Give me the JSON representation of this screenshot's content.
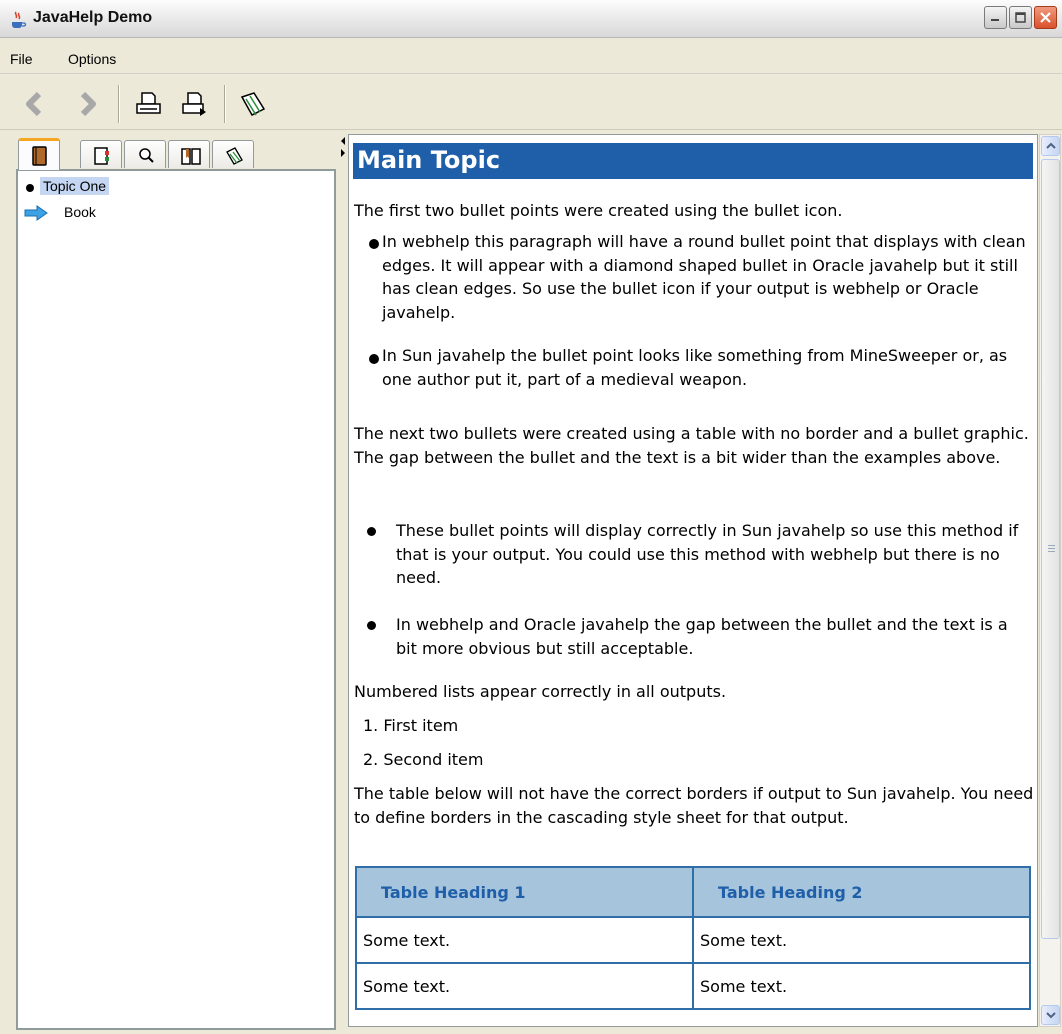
{
  "window": {
    "title": "JavaHelp Demo"
  },
  "menubar": {
    "items": [
      "File",
      "Options"
    ]
  },
  "toolbar": {
    "buttons": [
      "back-icon",
      "forward-icon",
      "print-icon",
      "page-setup-icon",
      "synchronize-icon"
    ]
  },
  "navigator": {
    "tabs": [
      "toc-icon",
      "index-icon",
      "search-icon",
      "glossary-icon",
      "favorites-icon"
    ],
    "items": [
      {
        "label": "Topic One",
        "icon": "bullet",
        "selected": true
      },
      {
        "label": "Book",
        "icon": "blue-arrow-icon"
      }
    ]
  },
  "content": {
    "heading": "Main Topic",
    "intro1": "The first two bullet points were created using the bullet icon.",
    "bullets1": [
      "In webhelp this paragraph will have a round bullet point that displays with clean edges. It will appear with a diamond shaped bullet in Oracle javahelp but it still has clean edges. So use the bullet icon if your output is webhelp or Oracle javahelp.",
      "In Sun javahelp the bullet point looks like something from MineSweeper or, as one author put it, part of a medieval weapon."
    ],
    "intro2": "The next two bullets were created using a table with no border and a bullet graphic. The gap between the bullet and the text is a bit wider than the examples above.",
    "bullets2": [
      "These bullet points will display correctly in Sun javahelp so use this method if that is your output. You could use this method with webhelp but there is no need.",
      "In webhelp and Oracle javahelp the gap between the bullet and the text is a bit more obvious but still acceptable."
    ],
    "intro3": "Numbered lists appear correctly in all outputs.",
    "numbered": [
      "1. First item",
      "2. Second item"
    ],
    "intro4": "The table below will not have the correct borders if output to Sun javahelp. You need to define borders in the cascading style sheet for that output.",
    "table": {
      "headers": [
        "Table Heading 1",
        "Table Heading 2"
      ],
      "rows": [
        [
          "Some text.",
          "Some text."
        ],
        [
          "Some text.",
          "Some text."
        ]
      ]
    }
  },
  "colors": {
    "heading_bg": "#1f5fa9",
    "table_border": "#2f6ea6",
    "table_header_bg": "#a6c4dc",
    "selection_bg": "#c5d6f2"
  }
}
